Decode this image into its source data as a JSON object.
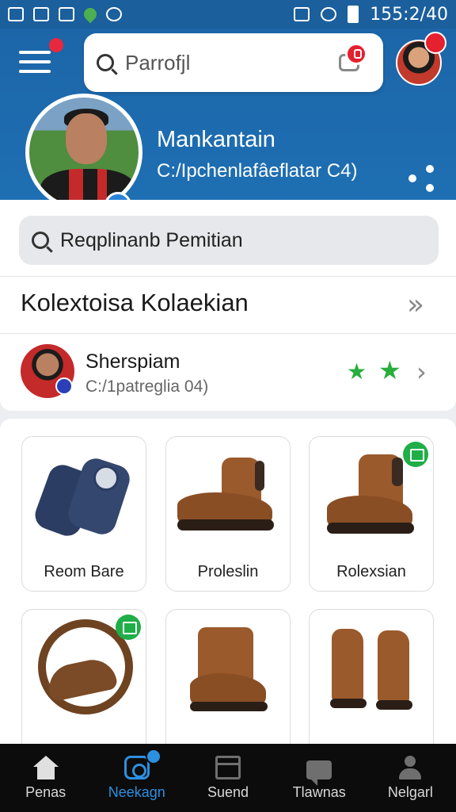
{
  "status_bar": {
    "time": "155:2/40"
  },
  "header": {
    "search_placeholder": "Parrofjl",
    "profile_name": "Mankantain",
    "profile_handle": "C:/Ipchenlafâeflatar C4)"
  },
  "search": {
    "placeholder": "Reqplinanb Pemitian"
  },
  "collection": {
    "title": "Kolextoisa Kolaekian"
  },
  "seller": {
    "name": "Sherspiam",
    "subtitle": "C:/1patreglia 04)",
    "stars": 2
  },
  "products": [
    {
      "label": "Reom Bare",
      "icon": "shin-guards"
    },
    {
      "label": "Proleslin",
      "icon": "leather-boot"
    },
    {
      "label": "Rolexsian",
      "icon": "leather-boot",
      "tag": true
    },
    {
      "label": "",
      "icon": "belt-holster",
      "tag": true
    },
    {
      "label": "",
      "icon": "ankle-boot"
    },
    {
      "label": "",
      "icon": "tall-boots"
    }
  ],
  "nav": [
    {
      "label": "Penas",
      "icon": "home-icon"
    },
    {
      "label": "Neekagn",
      "icon": "collection-icon",
      "active": true
    },
    {
      "label": "Suend",
      "icon": "store-icon"
    },
    {
      "label": "Tlawnas",
      "icon": "chat-icon"
    },
    {
      "label": "Nelgarl",
      "icon": "profile-icon"
    }
  ],
  "colors": {
    "primary": "#1e6fb3",
    "accent_green": "#27ae3d",
    "badge_red": "#e5202f",
    "nav_active": "#2d8fe0"
  }
}
